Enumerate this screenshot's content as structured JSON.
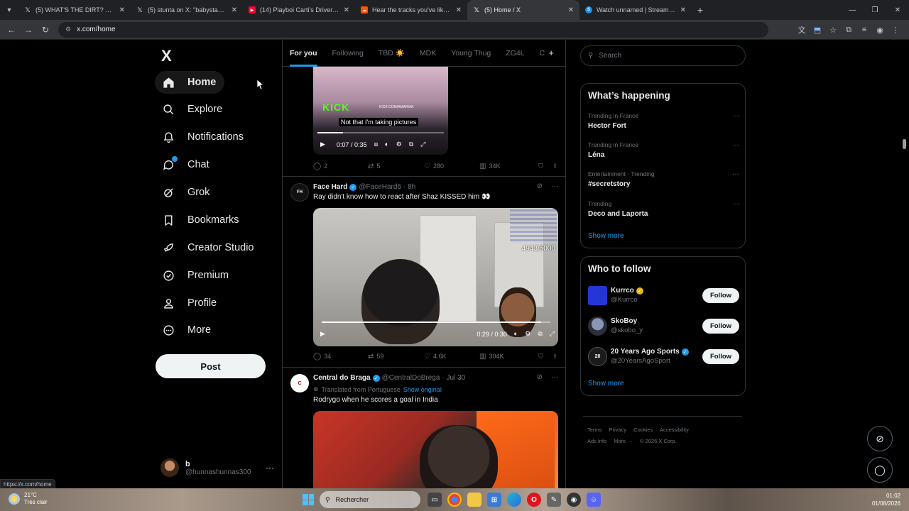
{
  "browser": {
    "tabs": [
      {
        "title": "(5) WHAT'S THE DIRT? on X: \"Th",
        "icon": "x-logo",
        "active": false
      },
      {
        "title": "(5) stunta on X: \"babystaydown",
        "icon": "x-logo",
        "active": false
      },
      {
        "title": "(14) Playboi Carti's Driver Assa",
        "icon": "youtube",
        "active": false
      },
      {
        "title": "Hear the tracks you've liked: on",
        "icon": "soundcloud",
        "active": false
      },
      {
        "title": "(5) Home / X",
        "icon": "x-logo",
        "active": true
      },
      {
        "title": "Watch unnamed | Streamable",
        "icon": "streamable",
        "active": false
      }
    ],
    "url": "x.com/home",
    "status_url": "https://x.com/home"
  },
  "nav": {
    "logo": "X",
    "items": [
      {
        "label": "Home",
        "icon": "home-icon"
      },
      {
        "label": "Explore",
        "icon": "search-icon"
      },
      {
        "label": "Notifications",
        "icon": "bell-icon"
      },
      {
        "label": "Chat",
        "icon": "chat-icon"
      },
      {
        "label": "Grok",
        "icon": "grok-icon"
      },
      {
        "label": "Bookmarks",
        "icon": "bookmark-icon"
      },
      {
        "label": "Creator Studio",
        "icon": "rocket-icon"
      },
      {
        "label": "Premium",
        "icon": "verified-icon"
      },
      {
        "label": "Profile",
        "icon": "person-icon"
      },
      {
        "label": "More",
        "icon": "more-circle-icon"
      }
    ],
    "post_label": "Post",
    "account": {
      "name": "b",
      "handle": "@hunnashunnas300"
    }
  },
  "timeline": {
    "tabs": [
      "For you",
      "Following",
      "TBD ☀️",
      "MDK",
      "Young Thug",
      "ZG4L",
      "C"
    ],
    "post1": {
      "kick_logo": "KICK",
      "kick_url": "KICK.COM/AMARIAK",
      "subtitle": "Not that I'm taking pictures",
      "time": "0:07 / 0:35",
      "replies": "2",
      "reposts": "5",
      "likes": "280",
      "views": "34K"
    },
    "post2": {
      "name": "Face Hard",
      "handle": "@FaceHard6",
      "time": "· 8h",
      "text": "Ray didn't know how to react after Shaz KISSED him 👀",
      "viewer_count": "4943/5000",
      "video_time": "0:29 / 0:30",
      "replies": "34",
      "reposts": "59",
      "likes": "4.6K",
      "views": "304K"
    },
    "post3": {
      "name": "Central do Braga",
      "handle": "@CentralDoBrega",
      "time": "· Jul 30",
      "translated": "Translated from Portuguese",
      "show_original": "Show original",
      "text": "Rodrygo when he scores a goal in India"
    }
  },
  "sidebar": {
    "search_placeholder": "Search",
    "happening_title": "What’s happening",
    "trends": [
      {
        "meta": "Trending in France",
        "name": "Hector Fort"
      },
      {
        "meta": "Trending in France",
        "name": "Léna"
      },
      {
        "meta": "Entertainment · Trending",
        "name": "#secretstory"
      },
      {
        "meta": "Trending",
        "name": "Deco and Laporta"
      }
    ],
    "show_more": "Show more",
    "wtf_title": "Who to follow",
    "follow_label": "Follow",
    "suggestions": [
      {
        "name": "Kurrco",
        "handle": "@Kurrco",
        "badge": "gold"
      },
      {
        "name": "SkoBoy",
        "handle": "@skobo_y",
        "badge": "none"
      },
      {
        "name": "20 Years Ago Sports",
        "handle": "@20YearsAgoSport",
        "badge": "blue"
      }
    ],
    "footer": [
      "Terms",
      "Privacy",
      "Cookies",
      "Accessibility",
      "Ads info",
      "More ···",
      "© 2026 X Corp."
    ]
  },
  "taskbar": {
    "temp": "21°C",
    "weather": "Très clair",
    "search": "Rechercher",
    "time": "01:02",
    "date": "01/08/2026"
  },
  "colors": {
    "accent": "#1d9bf0",
    "background": "#000000",
    "border": "#2f3336",
    "muted": "#71767b"
  }
}
